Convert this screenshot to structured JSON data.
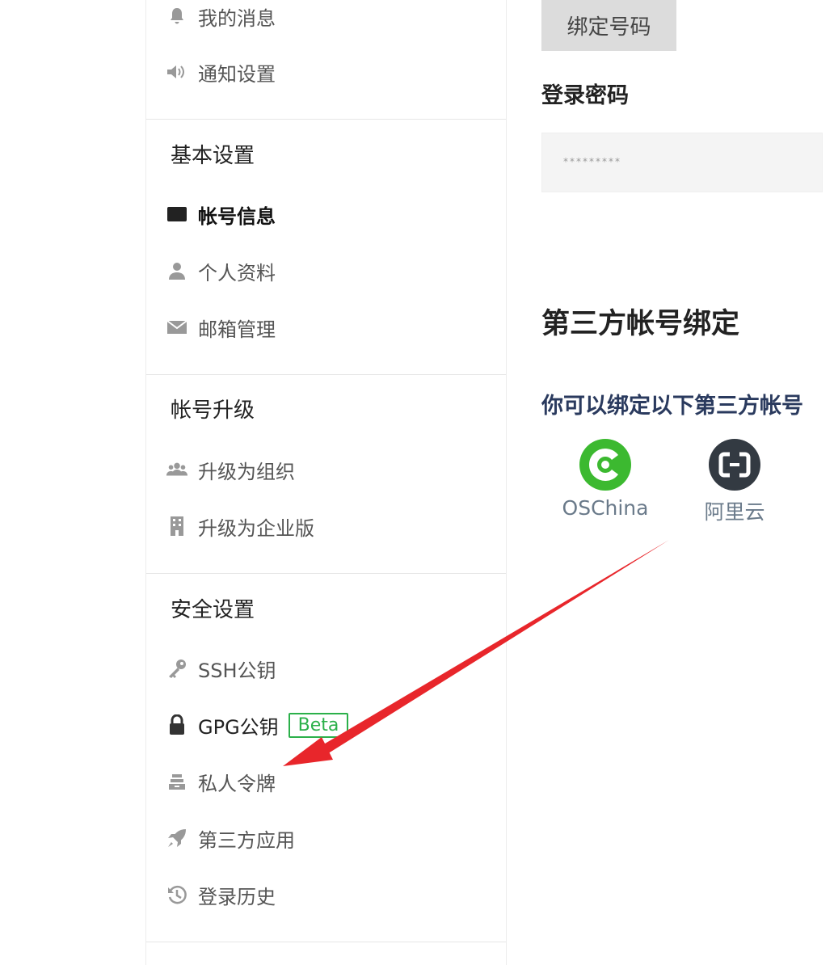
{
  "sidebar": {
    "top_items": [
      {
        "label": "我的消息",
        "icon": "bell-icon"
      },
      {
        "label": "通知设置",
        "icon": "speaker-icon"
      }
    ],
    "groups": [
      {
        "title": "基本设置",
        "items": [
          {
            "label": "帐号信息",
            "icon": "id-card-icon",
            "active": true
          },
          {
            "label": "个人资料",
            "icon": "user-icon"
          },
          {
            "label": "邮箱管理",
            "icon": "mail-icon"
          }
        ]
      },
      {
        "title": "帐号升级",
        "items": [
          {
            "label": "升级为组织",
            "icon": "team-icon"
          },
          {
            "label": "升级为企业版",
            "icon": "building-icon"
          }
        ]
      },
      {
        "title": "安全设置",
        "items": [
          {
            "label": "SSH公钥",
            "icon": "key-icon"
          },
          {
            "label": "GPG公钥",
            "icon": "lock-icon",
            "badge": "Beta"
          },
          {
            "label": "私人令牌",
            "icon": "token-icon"
          },
          {
            "label": "第三方应用",
            "icon": "rocket-icon"
          },
          {
            "label": "登录历史",
            "icon": "history-icon"
          }
        ]
      }
    ]
  },
  "main": {
    "bind_phone_button": "绑定号码",
    "password_label": "登录密码",
    "password_value": "*********",
    "third_party_title": "第三方帐号绑定",
    "third_party_desc": "你可以绑定以下第三方帐号",
    "providers": [
      {
        "name": "OSChina",
        "icon": "oschina-logo-icon",
        "color": "#3cb930"
      },
      {
        "name": "阿里云",
        "icon": "aliyun-logo-icon",
        "color": "#333a42"
      }
    ]
  },
  "annotation": {
    "arrow_color": "#e8262b"
  }
}
